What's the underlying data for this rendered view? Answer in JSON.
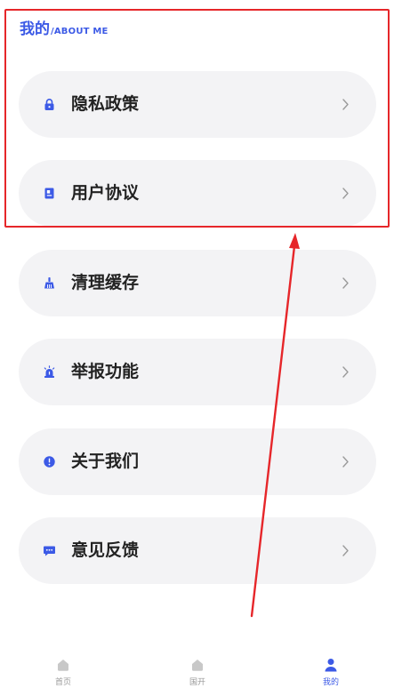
{
  "header": {
    "title_zh": "我的",
    "title_en": "/ABOUT ME"
  },
  "colors": {
    "accent": "#3c5ae6",
    "item_bg": "#f3f3f5",
    "annotation": "#e6262a",
    "tab_inactive": "#9a9a9a"
  },
  "menu": {
    "items": [
      {
        "label": "隐私政策",
        "icon": "lock-icon"
      },
      {
        "label": "用户协议",
        "icon": "document-icon"
      },
      {
        "label": "清理缓存",
        "icon": "broom-icon"
      },
      {
        "label": "举报功能",
        "icon": "alarm-icon"
      },
      {
        "label": "关于我们",
        "icon": "info-icon"
      },
      {
        "label": "意见反馈",
        "icon": "feedback-icon"
      }
    ]
  },
  "tabbar": {
    "tabs": [
      {
        "label": "首页",
        "icon": "home-icon",
        "active": false
      },
      {
        "label": "国开",
        "icon": "home-icon",
        "active": false
      },
      {
        "label": "我的",
        "icon": "person-icon",
        "active": true
      }
    ]
  }
}
